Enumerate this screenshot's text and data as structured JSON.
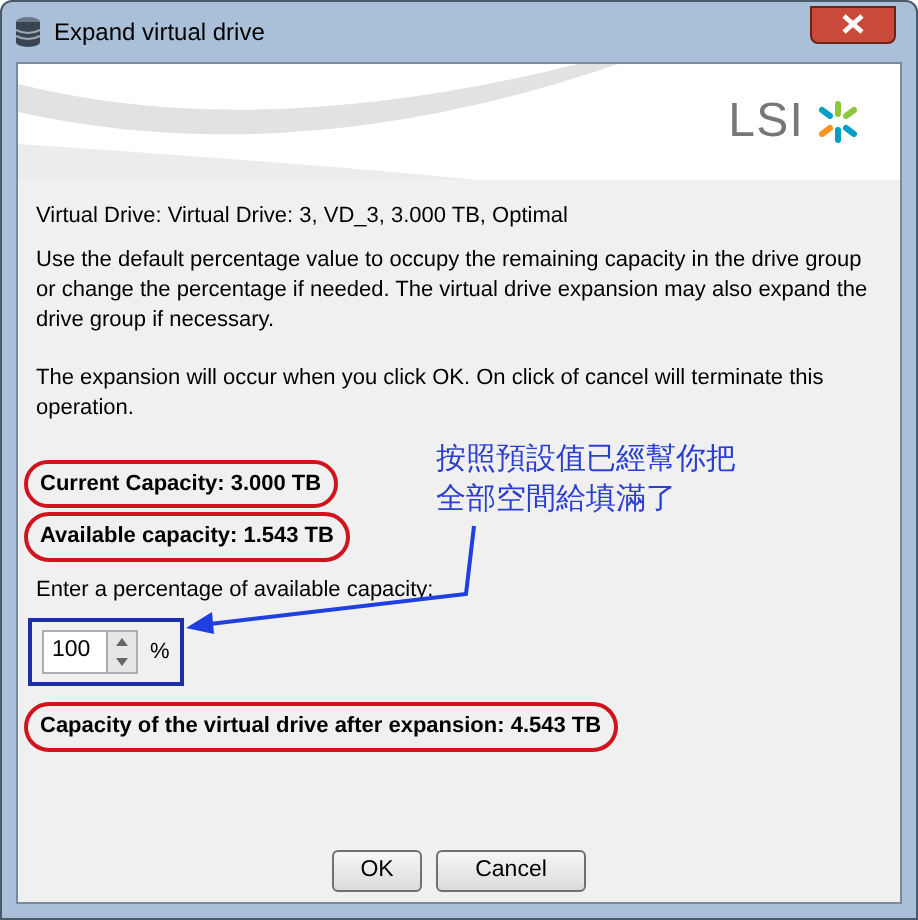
{
  "window": {
    "title": "Expand virtual drive"
  },
  "banner": {
    "logo": "LSI"
  },
  "virtual_drive": "Virtual Drive: Virtual Drive: 3, VD_3, 3.000 TB, Optimal",
  "description": [
    "Use the default percentage value to occupy the remaining capacity in the drive group or change the percentage if needed. The virtual drive expansion may also expand the drive group if necessary.",
    "The expansion will occur when you click OK. On click of cancel will terminate this operation."
  ],
  "capacities": [
    {
      "text": "Current Capacity: 3.000 TB",
      "circled": true
    },
    {
      "text": "Available capacity: 1.543 TB",
      "circled": true
    }
  ],
  "percentage": {
    "label": "Enter a percentage of available capacity:",
    "value": "100",
    "unit": "%",
    "boxed": true
  },
  "result": {
    "text": "Capacity of the virtual drive after expansion: 4.543 TB",
    "circled": true
  },
  "note": {
    "lines": [
      "按照預設值已經幫你把",
      "全部空間給填滿了"
    ]
  },
  "buttons": [
    "OK",
    "Cancel"
  ]
}
